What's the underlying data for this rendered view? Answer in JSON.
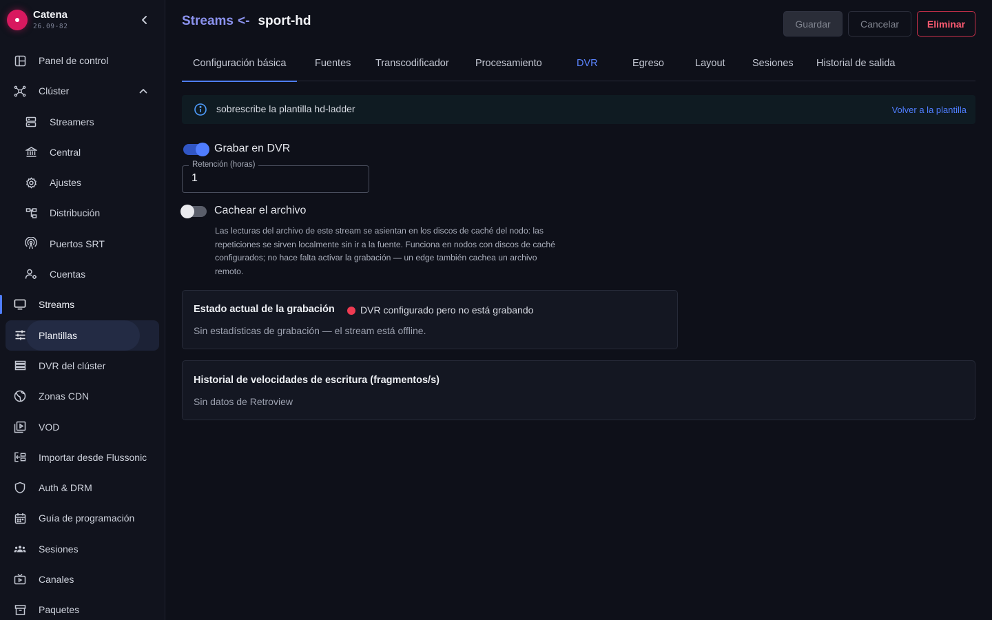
{
  "brand": {
    "name": "Catena",
    "version": "26.09-82"
  },
  "sidebar": {
    "items": [
      {
        "label": "Panel de control",
        "icon": "dashboard-icon"
      },
      {
        "label": "Clúster",
        "icon": "cluster-icon",
        "expanded": true
      },
      {
        "label": "Streamers",
        "icon": "server-icon"
      },
      {
        "label": "Central",
        "icon": "bank-icon"
      },
      {
        "label": "Ajustes",
        "icon": "gear-icon"
      },
      {
        "label": "Distribución",
        "icon": "distribution-icon"
      },
      {
        "label": "Puertos SRT",
        "icon": "antenna-icon"
      },
      {
        "label": "Cuentas",
        "icon": "accounts-icon"
      },
      {
        "label": "Streams",
        "icon": "monitor-icon",
        "active": true
      },
      {
        "label": "Plantillas",
        "icon": "sliders-icon",
        "highlighted": true
      },
      {
        "label": "DVR del clúster",
        "icon": "list-icon"
      },
      {
        "label": "Zonas CDN",
        "icon": "globe-icon"
      },
      {
        "label": "VOD",
        "icon": "video-library-icon"
      },
      {
        "label": "Importar desde Flussonic",
        "icon": "import-icon"
      },
      {
        "label": "Auth & DRM",
        "icon": "shield-icon"
      },
      {
        "label": "Guía de programación",
        "icon": "calendar-icon"
      },
      {
        "label": "Sesiones",
        "icon": "people-icon"
      },
      {
        "label": "Canales",
        "icon": "tv-icon"
      },
      {
        "label": "Paquetes",
        "icon": "archive-icon"
      }
    ]
  },
  "header": {
    "crumb": "Streams",
    "arrow": "<-",
    "title": "sport-hd",
    "save_label": "Guardar",
    "cancel_label": "Cancelar",
    "delete_label": "Eliminar"
  },
  "tabs": [
    {
      "label": "Configuración básica",
      "selected": true
    },
    {
      "label": "Fuentes"
    },
    {
      "label": "Transcodificador"
    },
    {
      "label": "Procesamiento"
    },
    {
      "label": "DVR"
    },
    {
      "label": "Egreso"
    },
    {
      "label": "Layout"
    },
    {
      "label": "Sesiones"
    },
    {
      "label": "Historial de salida"
    }
  ],
  "banner": {
    "text": "sobrescribe la plantilla hd-ladder",
    "link": "Volver a la plantilla"
  },
  "dvr": {
    "record_label": "Grabar en DVR",
    "record_on": true,
    "retention_label": "Retención (horas)",
    "retention_value": "1",
    "cache_label": "Cachear el archivo",
    "cache_on": false,
    "cache_help": "Las lecturas del archivo de este stream se asientan en los discos de caché del nodo: las repeticiones se sirven localmente sin ir a la fuente. Funciona en nodos con discos de caché configurados; no hace falta activar la grabación — un edge también cachea un archivo remoto."
  },
  "recording_status": {
    "title": "Estado actual de la grabación",
    "status": "DVR configurado pero no está grabando",
    "status_color": "#ef3b52",
    "detail": "Sin estadísticas de grabación — el stream está offline."
  },
  "write_history": {
    "title": "Historial de velocidades de escritura (fragmentos/s)",
    "detail": "Sin datos de Retroview"
  },
  "colors": {
    "accent": "#4f7dff",
    "danger": "#ff5b72",
    "brand": "#d8195f"
  }
}
